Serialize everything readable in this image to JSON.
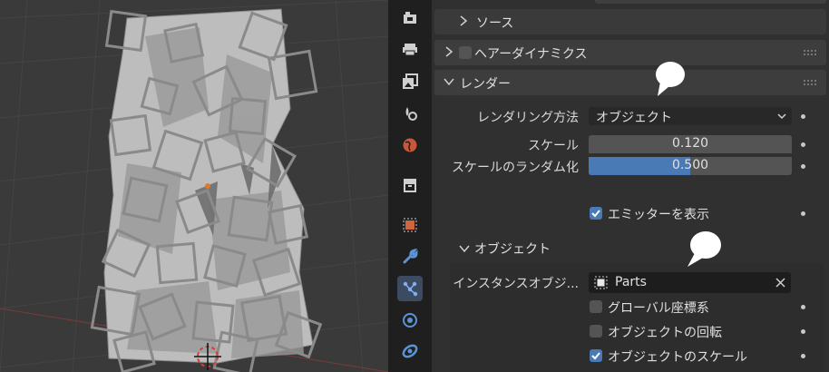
{
  "properties": {
    "source_panel": {
      "title": "ソース"
    },
    "hair_dynamics_panel": {
      "title": "ヘアーダイナミクス",
      "enabled": false
    },
    "render_panel": {
      "title": "レンダー",
      "render_as": {
        "label": "レンダリング方法",
        "value": "オブジェクト"
      },
      "scale": {
        "label": "スケール",
        "value": "0.120"
      },
      "scale_randomness": {
        "label": "スケールのランダム化",
        "value": "0.500",
        "fill_fraction": 0.5
      },
      "show_emitter": {
        "label": "エミッターを表示",
        "checked": true
      }
    },
    "object_subpanel": {
      "title": "オブジェクト",
      "instance_object": {
        "label": "インスタンスオブジ...",
        "value": "Parts"
      },
      "global_coordinates": {
        "label": "グローバル座標系",
        "checked": false
      },
      "object_rotation": {
        "label": "オブジェクトの回転",
        "checked": false
      },
      "object_scale": {
        "label": "オブジェクトのスケール",
        "checked": true
      }
    }
  },
  "tabs": [
    "render-tab",
    "output-tab",
    "view-layer-tab",
    "scene-tab",
    "world-tab",
    "collection-tab",
    "object-tab",
    "modifier-tab",
    "particles-tab",
    "physics-tab",
    "constraints-tab"
  ],
  "colors": {
    "accent_blue": "#4a7ab5",
    "active_tab": "#3d4b62",
    "panel_bg": "#303030",
    "viewport_bg": "#3a3a3a"
  }
}
